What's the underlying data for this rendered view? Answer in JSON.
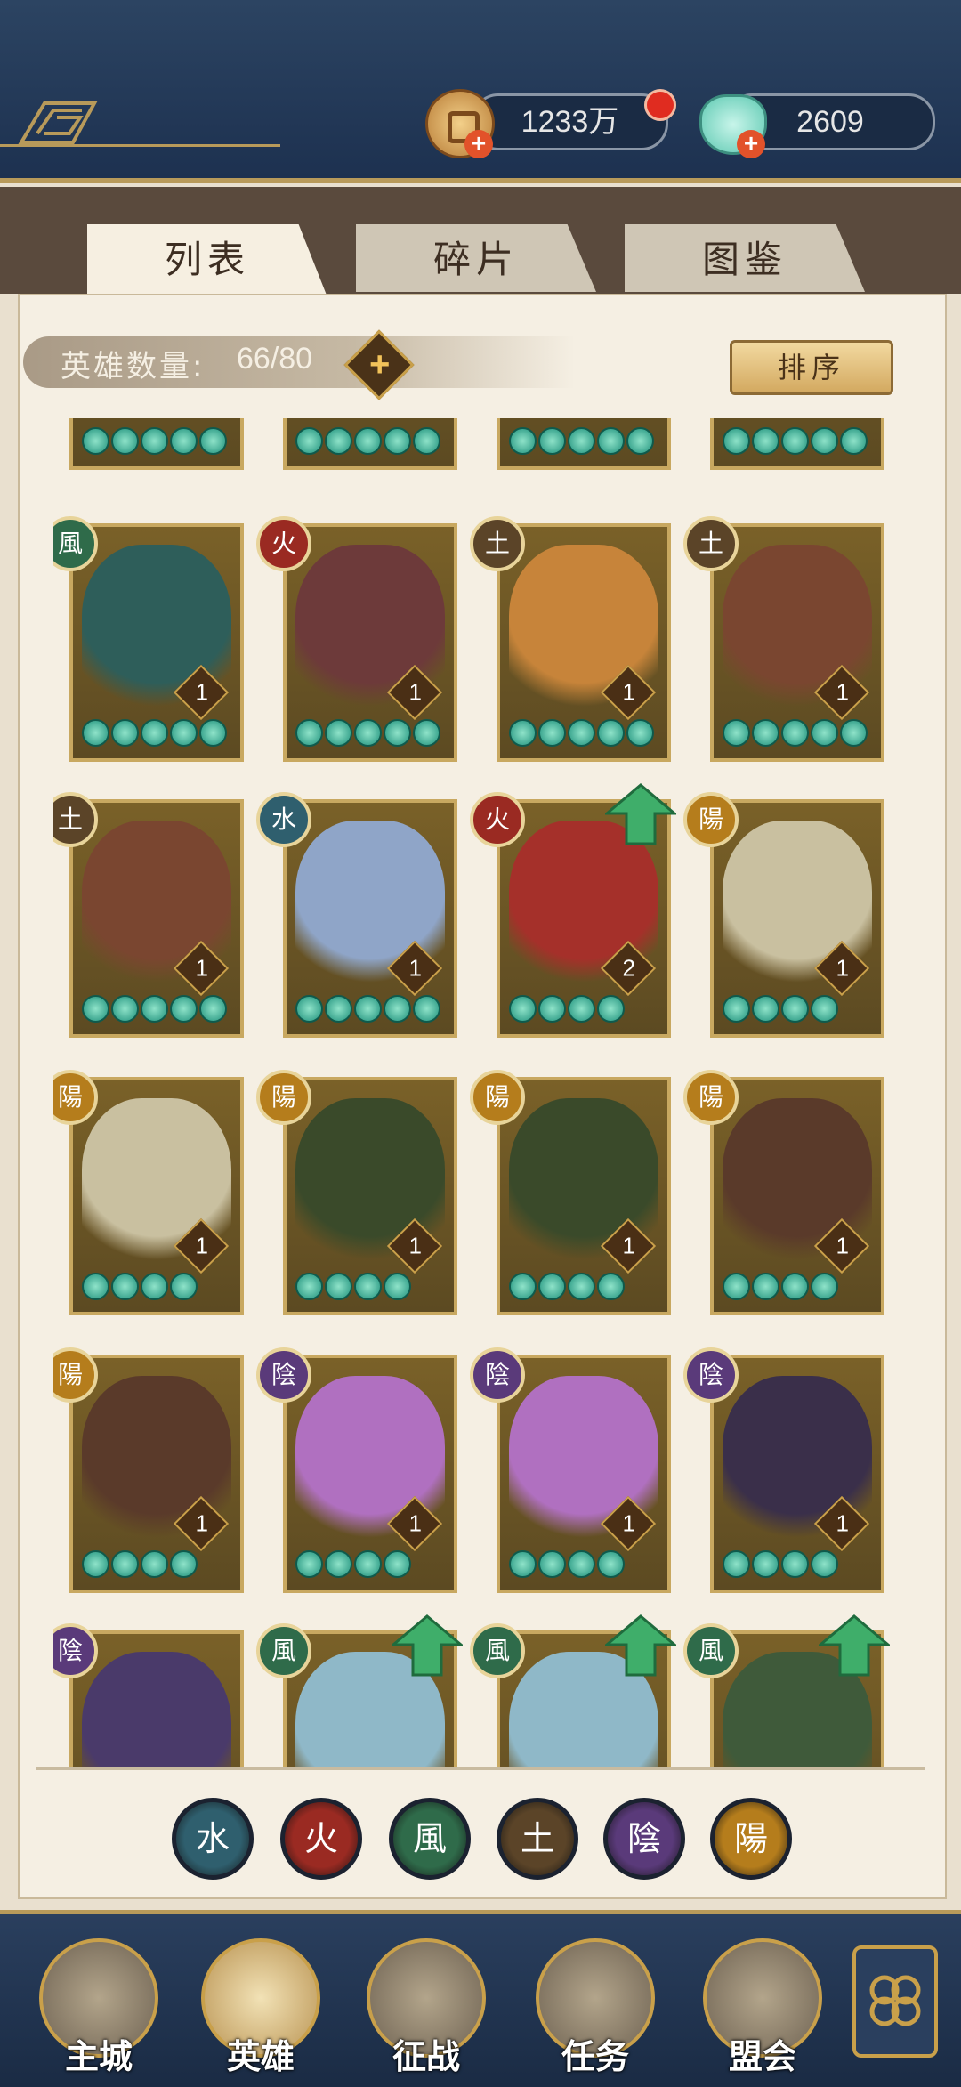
{
  "header": {
    "coins": "1233万",
    "gems": "2609"
  },
  "tabs": [
    {
      "label": "列表",
      "active": true
    },
    {
      "label": "碎片",
      "active": false
    },
    {
      "label": "图鉴",
      "active": false
    }
  ],
  "hero_count": {
    "label": "英雄数量:",
    "value": "66/80"
  },
  "sort_label": "排序",
  "element_colors": {
    "wind": "#2f6b4a",
    "fire": "#9a2a22",
    "earth": "#5b4428",
    "water": "#2f5f6e",
    "yin": "#5a3a7a",
    "yang": "#b57d1c"
  },
  "heroes": [
    {
      "element": "",
      "level": "",
      "stars": 5,
      "upgrade": false,
      "portrait": "#3f6d52"
    },
    {
      "element": "",
      "level": "",
      "stars": 5,
      "upgrade": false,
      "portrait": "#3b3a5a"
    },
    {
      "element": "",
      "level": "",
      "stars": 5,
      "upgrade": false,
      "portrait": "#5a3f2a"
    },
    {
      "element": "",
      "level": "",
      "stars": 5,
      "upgrade": false,
      "portrait": "#6a4a2a"
    },
    {
      "element": "wind",
      "glyph": "風",
      "level": "1",
      "stars": 5,
      "upgrade": false,
      "portrait": "#2e5e5a"
    },
    {
      "element": "fire",
      "glyph": "火",
      "level": "1",
      "stars": 5,
      "upgrade": false,
      "portrait": "#6d3a3a"
    },
    {
      "element": "earth",
      "glyph": "土",
      "level": "1",
      "stars": 5,
      "upgrade": false,
      "portrait": "#c7843a"
    },
    {
      "element": "earth",
      "glyph": "土",
      "level": "1",
      "stars": 5,
      "upgrade": false,
      "portrait": "#7a4630"
    },
    {
      "element": "earth",
      "glyph": "土",
      "level": "1",
      "stars": 5,
      "upgrade": false,
      "portrait": "#7a4630"
    },
    {
      "element": "water",
      "glyph": "水",
      "level": "1",
      "stars": 5,
      "upgrade": false,
      "portrait": "#8fa5c8"
    },
    {
      "element": "fire",
      "glyph": "火",
      "level": "2",
      "stars": 4,
      "upgrade": true,
      "portrait": "#a5302a"
    },
    {
      "element": "yang",
      "glyph": "陽",
      "level": "1",
      "stars": 4,
      "upgrade": false,
      "portrait": "#c9c0a0"
    },
    {
      "element": "yang",
      "glyph": "陽",
      "level": "1",
      "stars": 4,
      "upgrade": false,
      "portrait": "#c9c0a0"
    },
    {
      "element": "yang",
      "glyph": "陽",
      "level": "1",
      "stars": 4,
      "upgrade": false,
      "portrait": "#3a4a2a"
    },
    {
      "element": "yang",
      "glyph": "陽",
      "level": "1",
      "stars": 4,
      "upgrade": false,
      "portrait": "#3a4a2a"
    },
    {
      "element": "yang",
      "glyph": "陽",
      "level": "1",
      "stars": 4,
      "upgrade": false,
      "portrait": "#5a3a2a"
    },
    {
      "element": "yang",
      "glyph": "陽",
      "level": "1",
      "stars": 4,
      "upgrade": false,
      "portrait": "#5a3a2a"
    },
    {
      "element": "yin",
      "glyph": "陰",
      "level": "1",
      "stars": 4,
      "upgrade": false,
      "portrait": "#b070c0"
    },
    {
      "element": "yin",
      "glyph": "陰",
      "level": "1",
      "stars": 4,
      "upgrade": false,
      "portrait": "#b070c0"
    },
    {
      "element": "yin",
      "glyph": "陰",
      "level": "1",
      "stars": 4,
      "upgrade": false,
      "portrait": "#3a2f4a"
    },
    {
      "element": "yin",
      "glyph": "陰",
      "level": "",
      "stars": 0,
      "upgrade": false,
      "portrait": "#4a3a6a"
    },
    {
      "element": "wind",
      "glyph": "風",
      "level": "",
      "stars": 0,
      "upgrade": true,
      "portrait": "#8fb8c8"
    },
    {
      "element": "wind",
      "glyph": "風",
      "level": "",
      "stars": 0,
      "upgrade": true,
      "portrait": "#8fb8c8"
    },
    {
      "element": "wind",
      "glyph": "風",
      "level": "",
      "stars": 0,
      "upgrade": true,
      "portrait": "#3f5a3a"
    }
  ],
  "element_filters": [
    {
      "element": "water",
      "glyph": "水"
    },
    {
      "element": "fire",
      "glyph": "火"
    },
    {
      "element": "wind",
      "glyph": "風"
    },
    {
      "element": "earth",
      "glyph": "土"
    },
    {
      "element": "yin",
      "glyph": "陰"
    },
    {
      "element": "yang",
      "glyph": "陽"
    }
  ],
  "nav": [
    {
      "label": "主城",
      "icon": "castle-icon",
      "active": false
    },
    {
      "label": "英雄",
      "icon": "hero-portrait-icon",
      "active": true
    },
    {
      "label": "征战",
      "icon": "battle-drum-icon",
      "active": false
    },
    {
      "label": "任务",
      "icon": "scroll-task-icon",
      "active": false
    },
    {
      "label": "盟会",
      "icon": "alliance-pavilion-icon",
      "active": false
    }
  ],
  "nav_more_icon": "flower-menu-icon"
}
